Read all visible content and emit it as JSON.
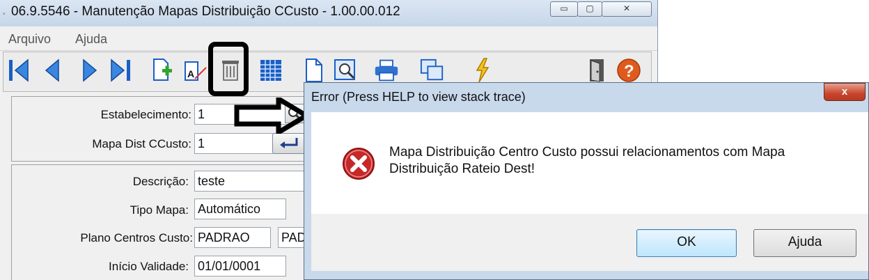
{
  "window": {
    "title": "06.9.5546 - Manutenção Mapas Distribuição CCusto - 1.00.00.012",
    "minimize": "▭",
    "maximize": "▢",
    "close": "✕"
  },
  "menu": {
    "items": [
      "Arquivo",
      "Ajuda"
    ]
  },
  "toolbar": {
    "icons": [
      "first-record-icon",
      "previous-record-icon",
      "next-record-icon",
      "last-record-icon",
      "new-record-icon",
      "edit-record-icon",
      "delete-record-icon",
      "table-view-icon",
      "blank-page-icon",
      "search-document-icon",
      "print-icon",
      "copy-icon",
      "execute-lightning-icon",
      "exit-door-icon",
      "help-icon"
    ]
  },
  "form": {
    "estabelecimento_label": "Estabelecimento:",
    "estabelecimento_value": "1",
    "mapa_label": "Mapa Dist CCusto:",
    "mapa_value": "1",
    "descricao_label": "Descrição:",
    "descricao_value": "teste",
    "tipo_mapa_label": "Tipo Mapa:",
    "tipo_mapa_value": "Automático",
    "plano_label": "Plano Centros Custo:",
    "plano_value": "PADRAO",
    "plano_value2": "PAD",
    "inicio_label": "Início Validade:",
    "inicio_value": "01/01/0001"
  },
  "dialog": {
    "title": "Error (Press HELP to view stack trace)",
    "close": "x",
    "message": "Mapa Distribuição Centro Custo possui relacionamentos com Mapa Distribuição Rateio Dest!",
    "ok_label": "OK",
    "help_label": "Ajuda"
  },
  "colors": {
    "toolbar_blue": "#1a5fc4",
    "error_red": "#c62828",
    "help_orange": "#e05a1e",
    "ok_button_border": "#3c7fb1"
  }
}
